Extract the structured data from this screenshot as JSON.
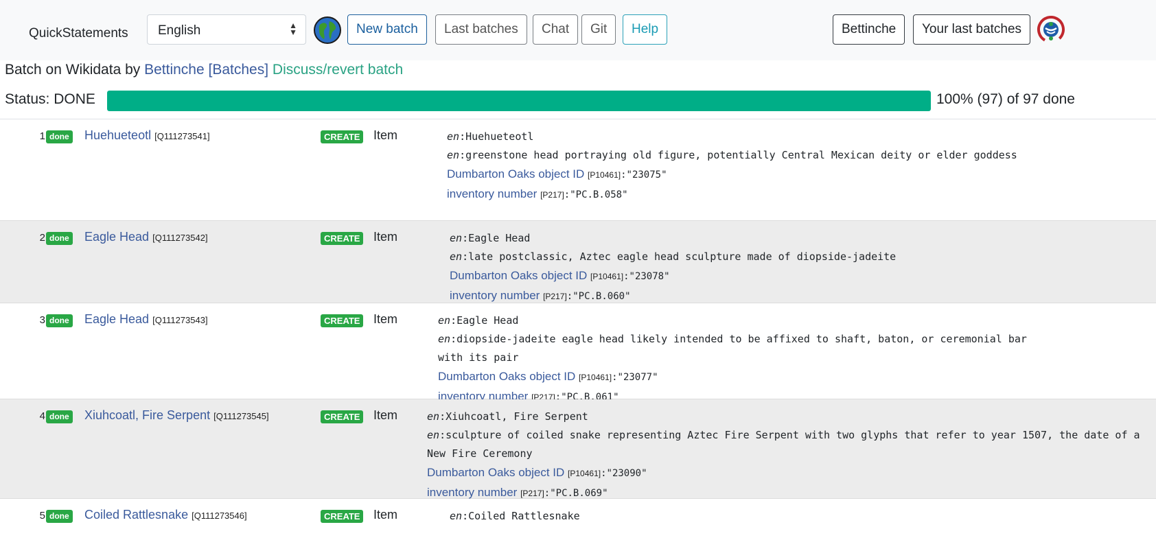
{
  "navbar": {
    "brand": "QuickStatements",
    "language": "English",
    "globe_icon": "globe-icon",
    "buttons": {
      "new_batch": "New batch",
      "last_batches": "Last batches",
      "chat": "Chat",
      "git": "Git",
      "help": "Help"
    },
    "user": "Bettinche",
    "your_last_batches": "Your last batches",
    "wikimedia_icon": "wikimedia-cloud-icon"
  },
  "batch": {
    "prefix": "Batch on Wikidata by",
    "user": "Bettinche",
    "batches_link": "[Batches]",
    "discuss_link": "Discuss/revert batch"
  },
  "status": {
    "label": "Status: DONE",
    "progress_fraction": 1.0,
    "text": "100% (97) of 97 done"
  },
  "colors": {
    "progress": "#00ae87",
    "badge": "#29a745",
    "link": "#3a5a9c",
    "green_link": "#29a283",
    "alt_row": "#ececec"
  },
  "commands": [
    {
      "num": "1",
      "status": "done",
      "label": "Huehueteotl",
      "qid": "[Q111273541]",
      "action": "CREATE",
      "type": "Item",
      "label_lang": "en",
      "label_text": "Huehueteotl",
      "desc_lang": "en",
      "desc_text": "greenstone head portraying old figure, potentially Central Mexican deity or elder goddess",
      "props": [
        {
          "name": "Dumbarton Oaks object ID",
          "pid": "[P10461]",
          "value": ":\"23075\""
        },
        {
          "name": "inventory number",
          "pid": "[P217]",
          "value": ":\"PC.B.058\""
        }
      ]
    },
    {
      "num": "2",
      "status": "done",
      "label": "Eagle Head",
      "qid": "[Q111273542]",
      "action": "CREATE",
      "type": "Item",
      "label_lang": "en",
      "label_text": "Eagle Head",
      "desc_lang": "en",
      "desc_text": "late postclassic, Aztec eagle head sculpture made of diopside-jadeite",
      "props": [
        {
          "name": "Dumbarton Oaks object ID",
          "pid": "[P10461]",
          "value": ":\"23078\""
        },
        {
          "name": "inventory number",
          "pid": "[P217]",
          "value": ":\"PC.B.060\""
        }
      ]
    },
    {
      "num": "3",
      "status": "done",
      "label": "Eagle Head",
      "qid": "[Q111273543]",
      "action": "CREATE",
      "type": "Item",
      "label_lang": "en",
      "label_text": "Eagle Head",
      "desc_lang": "en",
      "desc_text": "diopside-jadeite eagle head likely intended to be affixed to shaft, baton, or ceremonial bar with its pair",
      "props": [
        {
          "name": "Dumbarton Oaks object ID",
          "pid": "[P10461]",
          "value": ":\"23077\""
        },
        {
          "name": "inventory number",
          "pid": "[P217]",
          "value": ":\"PC.B.061\""
        }
      ]
    },
    {
      "num": "4",
      "status": "done",
      "label": "Xiuhcoatl, Fire Serpent",
      "qid": "[Q111273545]",
      "action": "CREATE",
      "type": "Item",
      "label_lang": "en",
      "label_text": "Xiuhcoatl, Fire Serpent",
      "desc_lang": "en",
      "desc_text": "sculpture of coiled snake representing Aztec Fire Serpent with two glyphs that refer to year 1507, the date of a New Fire Ceremony",
      "props": [
        {
          "name": "Dumbarton Oaks object ID",
          "pid": "[P10461]",
          "value": ":\"23090\""
        },
        {
          "name": "inventory number",
          "pid": "[P217]",
          "value": ":\"PC.B.069\""
        }
      ]
    },
    {
      "num": "5",
      "status": "done",
      "label": "Coiled Rattlesnake",
      "qid": "[Q111273546]",
      "action": "CREATE",
      "type": "Item",
      "label_lang": "en",
      "label_text": "Coiled Rattlesnake",
      "desc_lang": "",
      "desc_text": "",
      "props": []
    }
  ]
}
